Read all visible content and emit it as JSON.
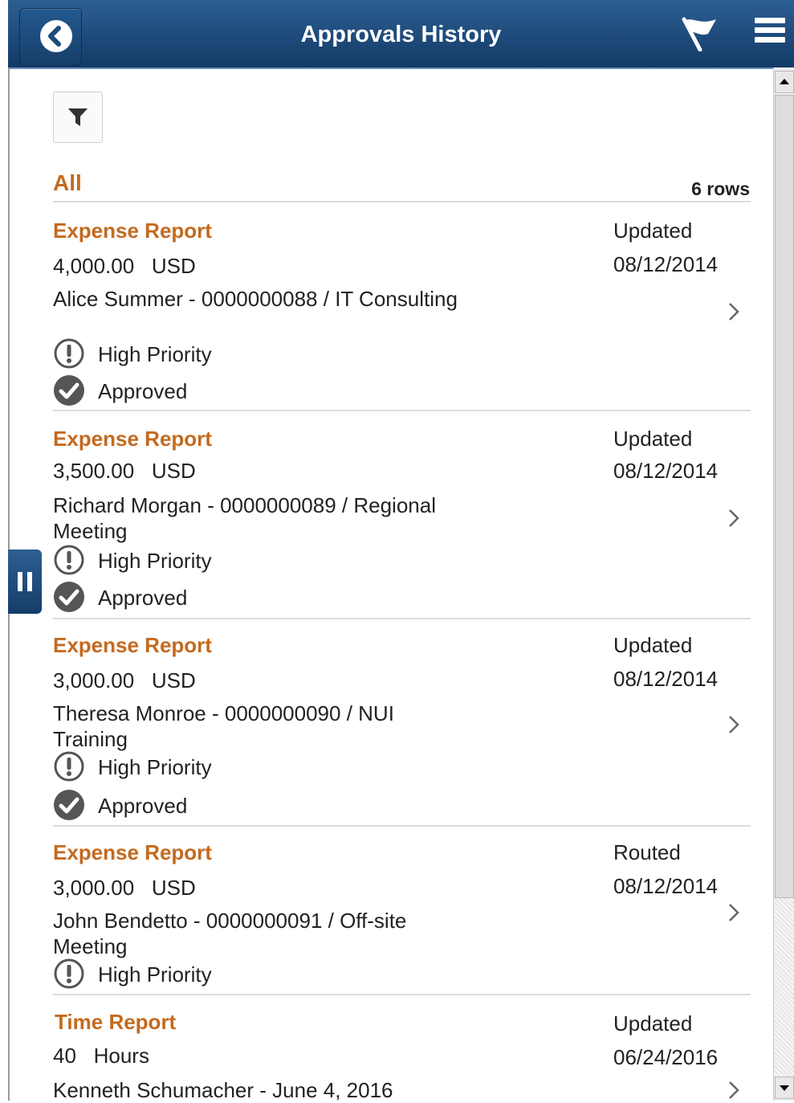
{
  "header": {
    "title": "Approvals History"
  },
  "group": {
    "title": "All",
    "row_count": "6 rows"
  },
  "items": [
    {
      "title": "Expense Report",
      "amount": "4,000.00",
      "unit": "USD",
      "desc": "Alice Summer - 0000000088 / IT Consulting",
      "priority": "High Priority",
      "status": "Approved",
      "action": "Updated",
      "date": "08/12/2014"
    },
    {
      "title": "Expense Report",
      "amount": "3,500.00",
      "unit": "USD",
      "desc": "Richard Morgan - 0000000089 / Regional Meeting",
      "priority": "High Priority",
      "status": "Approved",
      "action": "Updated",
      "date": "08/12/2014"
    },
    {
      "title": "Expense Report",
      "amount": "3,000.00",
      "unit": "USD",
      "desc": "Theresa Monroe - 0000000090 / NUI Training",
      "priority": "High Priority",
      "status": "Approved",
      "action": "Updated",
      "date": "08/12/2014"
    },
    {
      "title": "Expense Report",
      "amount": "3,000.00",
      "unit": "USD",
      "desc": "John Bendetto - 0000000091 / Off-site Meeting",
      "priority": "High Priority",
      "status": "",
      "action": "Routed",
      "date": "08/12/2014"
    },
    {
      "title": "Time Report",
      "amount": "40",
      "unit": "Hours",
      "desc": "Kenneth Schumacher - June 4, 2016",
      "priority": "",
      "status": "",
      "action": "Updated",
      "date": "06/24/2016"
    }
  ],
  "icons": {
    "back": "chevron-left-icon",
    "flag": "flag-icon",
    "menu": "hamburger-menu-icon",
    "filter": "filter-icon",
    "priority": "exclamation-circle-icon",
    "approved": "check-circle-icon",
    "row_nav": "chevron-right-icon"
  },
  "colors": {
    "header": "#1d4a7a",
    "accent": "#c46a1e"
  }
}
